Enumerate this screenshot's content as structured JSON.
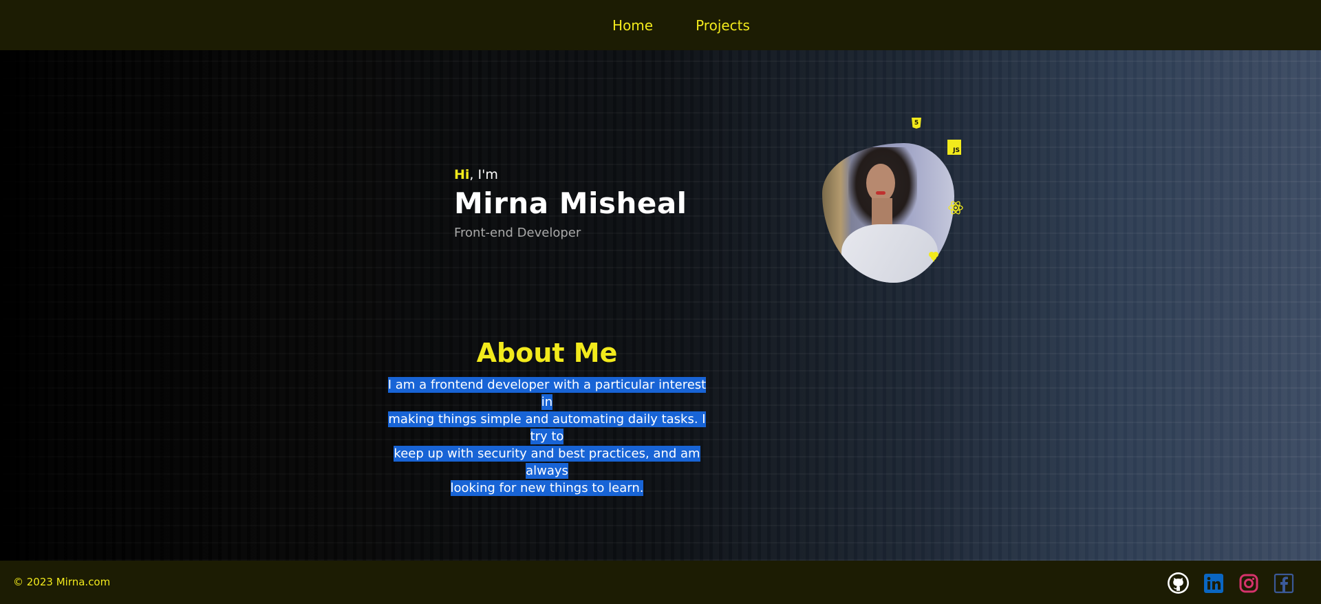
{
  "nav": {
    "items": [
      {
        "label": "Home"
      },
      {
        "label": "Projects"
      }
    ]
  },
  "hero": {
    "greeting_hi": "Hi",
    "greeting_rest": ", I'm",
    "name": "Mirna Misheal",
    "role": "Front-end Developer"
  },
  "about": {
    "title": "About Me",
    "lines": [
      "I am a frontend developer with a particular interest in",
      "making things simple and automating daily tasks. I try to",
      "keep up with security and best practices, and am always",
      "looking for new things to learn."
    ]
  },
  "avatar": {
    "tech_icons": [
      "html5-icon",
      "javascript-icon",
      "react-icon",
      "nodejs-icon"
    ],
    "js_label": "JS",
    "html_label": "5"
  },
  "footer": {
    "copyright": "© 2023 Mirna.com",
    "socials": [
      "github-icon",
      "linkedin-icon",
      "instagram-icon",
      "facebook-icon"
    ]
  },
  "colors": {
    "accent": "#f2ea1c",
    "bar": "#1c1c03",
    "selection": "#1864d6",
    "linkedin": "#0a66c2",
    "instagram": "#d6336c",
    "facebook": "#3b5998"
  }
}
